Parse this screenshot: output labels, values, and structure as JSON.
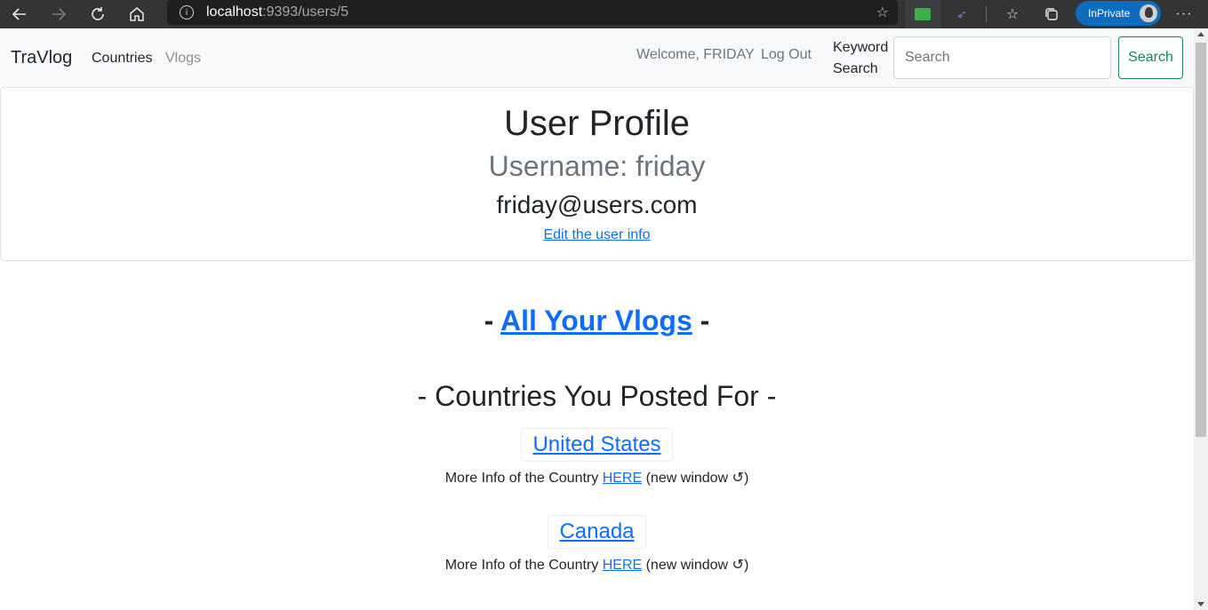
{
  "browser": {
    "url_host": "localhost",
    "url_path": ":9393/users/5",
    "inprivate_label": "InPrivate",
    "icons": [
      "back-arrow-icon",
      "forward-arrow-icon",
      "refresh-icon",
      "home-icon",
      "info-icon",
      "add-favorite-icon",
      "extension-icon",
      "extension-icon",
      "favorites-icon",
      "collections-icon",
      "more-icon"
    ]
  },
  "navbar": {
    "brand": "TraVlog",
    "links": {
      "countries": "Countries",
      "vlogs": "Vlogs"
    },
    "welcome": "Welcome, FRIDAY",
    "logout": "Log Out",
    "keyword_label": "Keyword Search",
    "search_placeholder": "Search",
    "search_button": "Search"
  },
  "profile": {
    "title": "User Profile",
    "username": "Username: friday",
    "email": "friday@users.com",
    "edit_link": "Edit the user info"
  },
  "main": {
    "vlogs_prefix": "- ",
    "vlogs_link": "All Your Vlogs",
    "vlogs_suffix": " -",
    "countries_heading": "- Countries You Posted For -",
    "countries": [
      {
        "name": "United States",
        "info_prefix": "More Info of the Country ",
        "info_link": "HERE",
        "info_suffix": " (new window ↺)"
      },
      {
        "name": "Canada",
        "info_prefix": "More Info of the Country ",
        "info_link": "HERE",
        "info_suffix": " (new window ↺)"
      }
    ]
  },
  "colors": {
    "link": "#0d6efd",
    "success": "#198754",
    "muted": "#6c757d",
    "navbar_bg": "#f8f9fa",
    "inprivate_badge": "#0f6cbd"
  }
}
